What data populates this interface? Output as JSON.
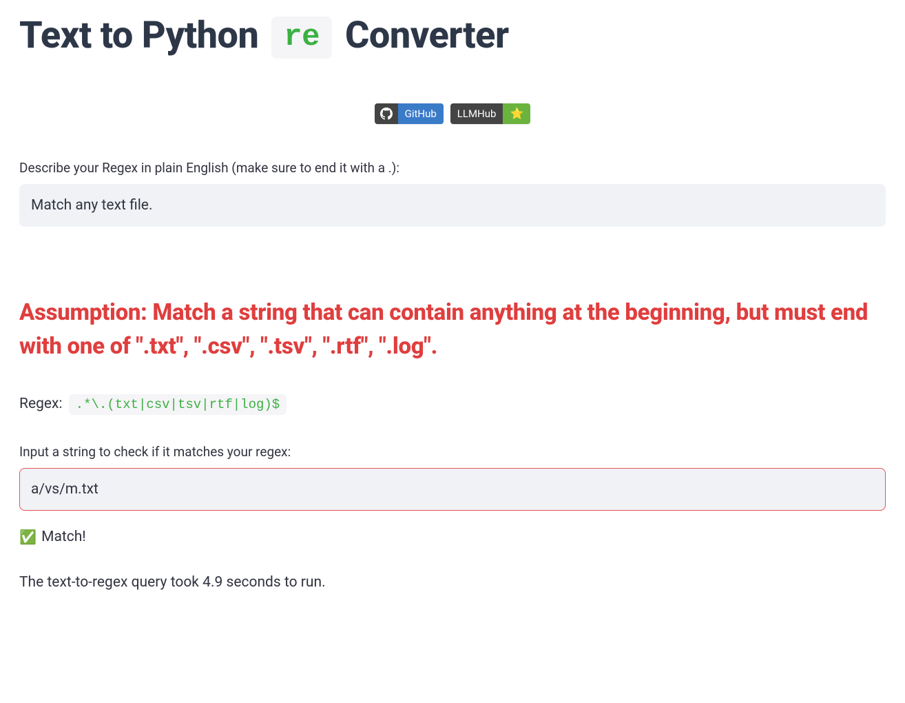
{
  "title": {
    "part1": "Text to Python ",
    "pill": "re",
    "part2": " Converter"
  },
  "badges": {
    "github_label": "GitHub",
    "llmhub_label": "LLMHub"
  },
  "prompt": {
    "label": "Describe your Regex in plain English (make sure to end it with a .):",
    "value": "Match any text file."
  },
  "assumption": "Assumption: Match a string that can contain anything at the beginning, but must end with one of \".txt\", \".csv\", \".tsv\", \".rtf\", \".log\".",
  "regex": {
    "label": "Regex:",
    "value": ".*\\.(txt|csv|tsv|rtf|log)$"
  },
  "test": {
    "label": "Input a string to check if it matches your regex:",
    "value": "a/vs/m.txt"
  },
  "result": {
    "emoji": "✅",
    "text": " Match!"
  },
  "timing": "The text-to-regex query took 4.9 seconds to run."
}
